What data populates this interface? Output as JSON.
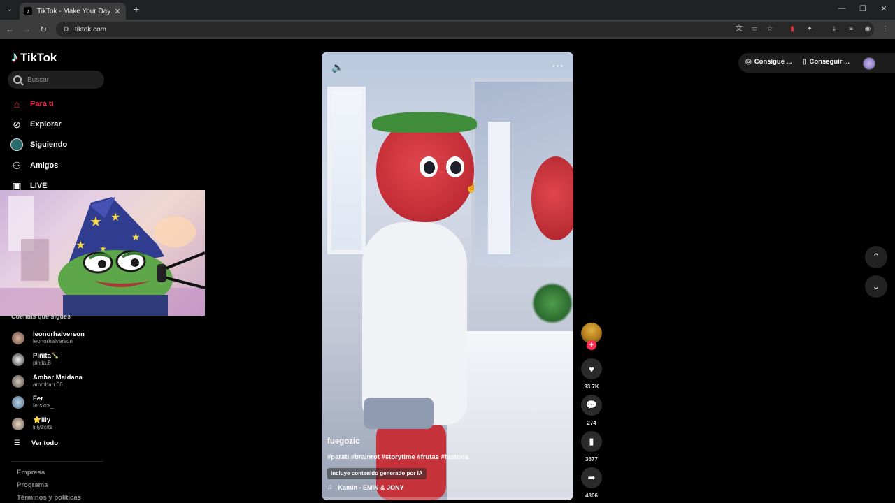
{
  "browser": {
    "tab_title": "TikTok - Make Your Day",
    "url": "tiktok.com"
  },
  "sidebar": {
    "logo_text": "TikTok",
    "search_placeholder": "Buscar",
    "nav": [
      {
        "label": "Para ti",
        "icon": "home-icon",
        "active": true
      },
      {
        "label": "Explorar",
        "icon": "compass-icon",
        "active": false
      },
      {
        "label": "Siguiendo",
        "icon": "following-icon",
        "active": false
      },
      {
        "label": "Amigos",
        "icon": "friends-icon",
        "active": false
      },
      {
        "label": "LIVE",
        "icon": "live-icon",
        "active": false
      }
    ],
    "following_title": "Cuentas que sigues",
    "accounts": [
      {
        "name": "leonorhalverson",
        "handle": "leonorhalverson"
      },
      {
        "name": "Piñita🍾",
        "handle": "pinita.8"
      },
      {
        "name": "Ambar Maidana",
        "handle": "ammbarr.06"
      },
      {
        "name": "Fer",
        "handle": "fersxcs_"
      },
      {
        "name": "⭐lily",
        "handle": "lillyzxrta"
      }
    ],
    "see_all": "Ver todo",
    "footer": [
      "Empresa",
      "Programa",
      "Términos y políticas"
    ]
  },
  "video": {
    "author": "fuegozic",
    "hashtags": "#parati #brainrot #storytime #frutas #historia",
    "ai_label": "Incluye contenido generado por IA",
    "music": "Kamin - EMIN & JONY"
  },
  "actions": {
    "likes": "93.7K",
    "comments": "274",
    "saves": "3677",
    "shares": "4306"
  },
  "topbar": {
    "coins_label": "Consigue ...",
    "app_label": "Conseguir ..."
  },
  "colors": {
    "accent": "#fe2c55",
    "background": "#000000"
  }
}
